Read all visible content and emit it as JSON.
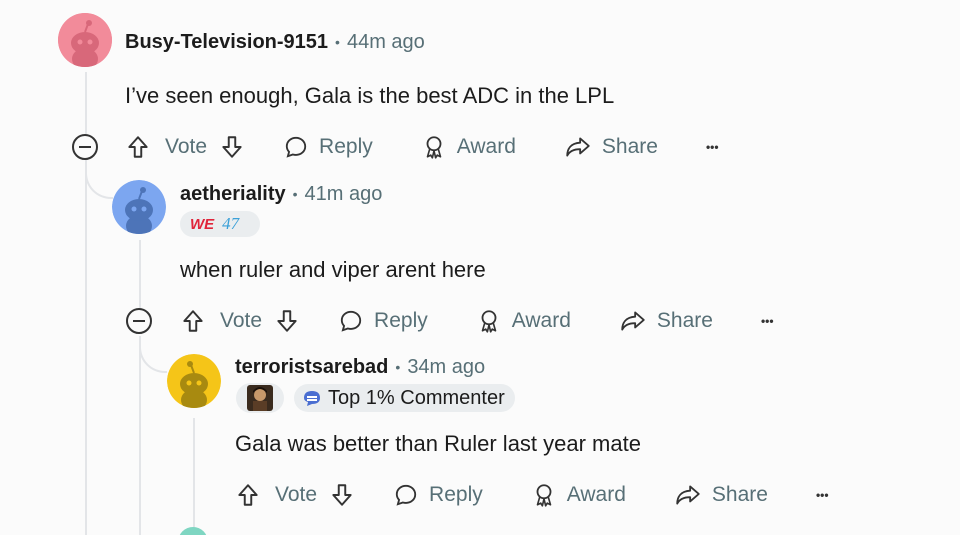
{
  "comments": [
    {
      "username": "Busy-Television-9151",
      "separator": "•",
      "time": "44m ago",
      "body": "I’ve seen enough, Gala is the best ADC in the LPL",
      "avatar_color": "#f28b9a",
      "actions": {
        "vote": "Vote",
        "reply": "Reply",
        "award": "Award",
        "share": "Share",
        "more": "•••"
      }
    },
    {
      "username": "aetheriality",
      "separator": "•",
      "time": "41m ago",
      "flair_text_1": "WE",
      "flair_text_2": "47",
      "body": "when ruler and viper arent here",
      "avatar_color": "#7ca6f0",
      "actions": {
        "vote": "Vote",
        "reply": "Reply",
        "award": "Award",
        "share": "Share",
        "more": "•••"
      }
    },
    {
      "username": "terroristsarebad",
      "separator": "•",
      "time": "34m ago",
      "badge": "Top 1% Commenter",
      "body": "Gala was better than Ruler last year mate",
      "avatar_color": "#f5c518",
      "actions": {
        "vote": "Vote",
        "reply": "Reply",
        "award": "Award",
        "share": "Share",
        "more": "•••"
      }
    }
  ],
  "colors": {
    "text_primary": "#1c1c1c",
    "text_secondary": "#576f76",
    "thread_line": "#e3e5e8",
    "flair_red": "#e0243a",
    "flair_blue": "#3aa0d8"
  }
}
